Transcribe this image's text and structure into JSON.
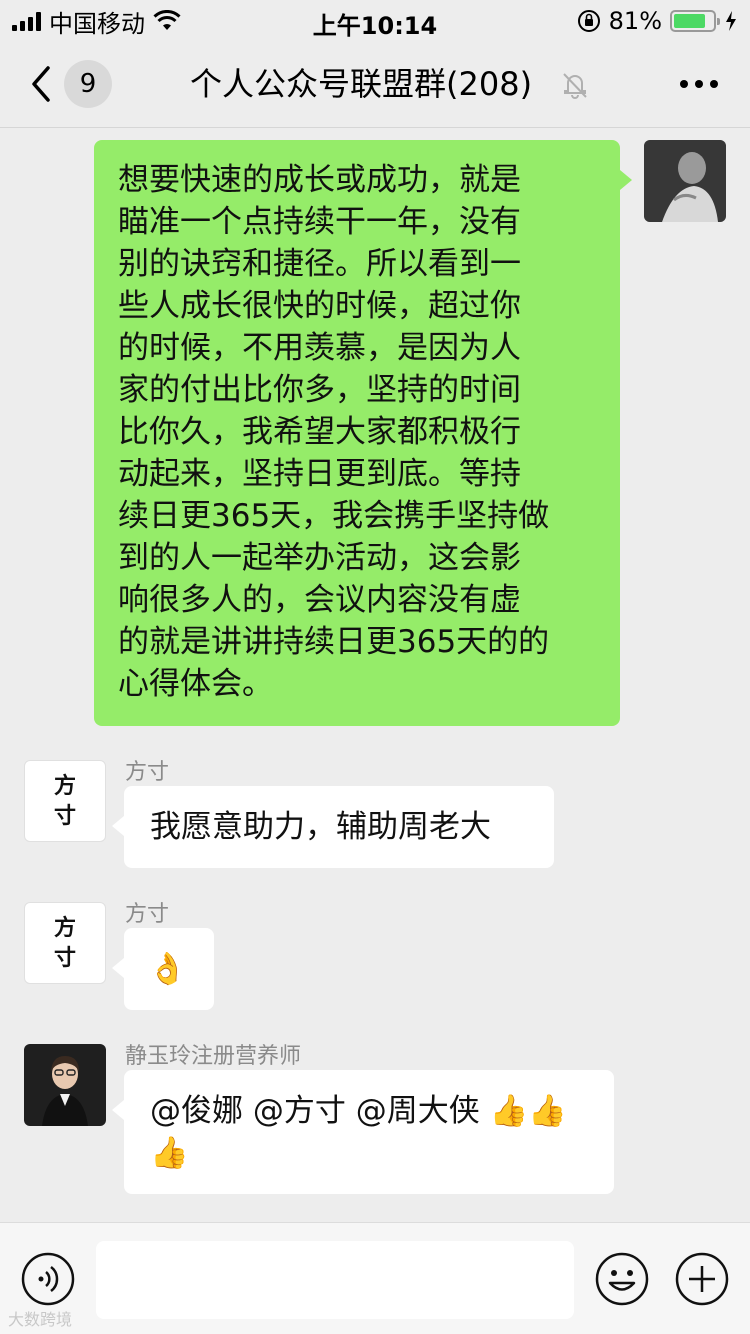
{
  "status_bar": {
    "carrier": "中国移动",
    "time": "上午10:14",
    "battery": "81%",
    "battery_level": 0.81,
    "icons": [
      "signal-icon",
      "wifi-icon",
      "orientation-lock-icon",
      "battery-icon",
      "charging-icon"
    ]
  },
  "nav": {
    "unread_count": "9",
    "title": "个人公众号联盟群(208)",
    "icons": [
      "back-chevron-icon",
      "mute-bell-icon",
      "more-dots-icon"
    ]
  },
  "messages": [
    {
      "side": "right",
      "lines": [
        "想要快速的成长或成功，就是",
        "瞄准一个点持续干一年，没有",
        "别的诀窍和捷径。所以看到一",
        "些人成长很快的时候，超过你",
        "的时候，不用羡慕，是因为人",
        "家的付出比你多，坚持的时间",
        "比你久，我希望大家都积极行",
        "动起来，坚持日更到底。等持",
        "续日更365天，我会携手坚持做",
        "到的人一起举办活动，这会影",
        "响很多人的，会议内容没有虚",
        "的就是讲讲持续日更365天的的",
        "心得体会。"
      ]
    },
    {
      "side": "left",
      "sender": "方寸",
      "avatar_text": "方\n寸",
      "text": "我愿意助力，辅助周老大"
    },
    {
      "side": "left",
      "sender": "方寸",
      "avatar_text": "方\n寸",
      "emoji": "👌"
    },
    {
      "side": "left",
      "sender": "静玉玲注册营养师",
      "line1": "@俊娜 @方寸 @周大侠 👍👍",
      "line2": "👍"
    }
  ],
  "input_bar": {
    "icons": [
      "voice-icon",
      "emoji-icon",
      "plus-icon"
    ],
    "text_value": ""
  },
  "watermark": "大数跨境",
  "colors": {
    "background": "#ededed",
    "green_bubble": "#95ec69",
    "white_bubble": "#ffffff",
    "battery_green": "#4cd964"
  }
}
